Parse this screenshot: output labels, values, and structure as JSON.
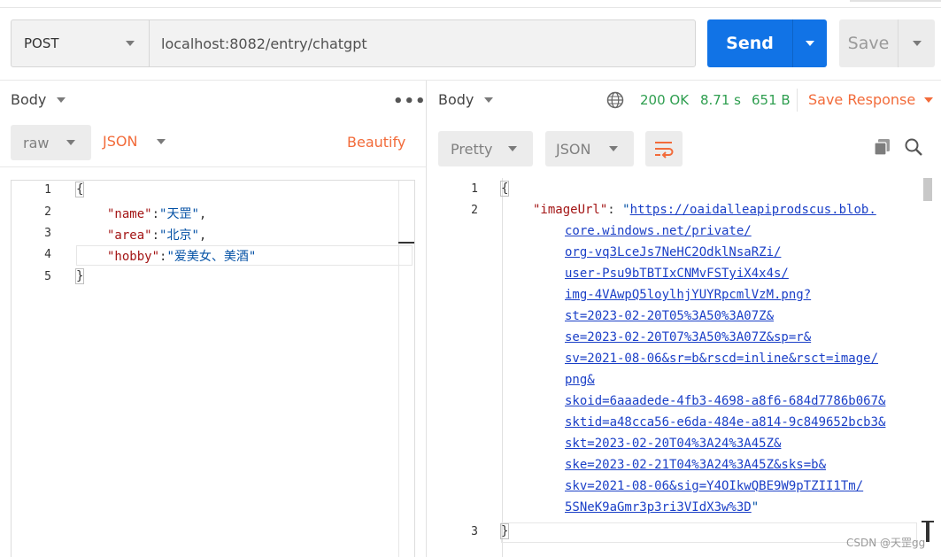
{
  "request": {
    "method": "POST",
    "url": "localhost:8082/entry/chatgpt",
    "send_label": "Send",
    "save_label": "Save"
  },
  "request_body": {
    "tab_label": "Body",
    "more_label": "•••",
    "mode": "raw",
    "format": "JSON",
    "beautify_label": "Beautify",
    "line_numbers": [
      "1",
      "2",
      "3",
      "4",
      "5"
    ],
    "lines": [
      {
        "open": "{"
      },
      {
        "key": "\"name\"",
        "colon": ":",
        "value": "\"天罡\"",
        "comma": ","
      },
      {
        "key": "\"area\"",
        "colon": ":",
        "value": "\"北京\"",
        "comma": ","
      },
      {
        "key": "\"hobby\"",
        "colon": ":",
        "value": "\"爱美女、美酒\"",
        "comma": ""
      },
      {
        "close": "}"
      }
    ]
  },
  "response": {
    "tab_label": "Body",
    "status": "200 OK",
    "time": "8.71 s",
    "size": "651 B",
    "save_response_label": "Save Response",
    "view_mode": "Pretty",
    "format": "JSON",
    "line_numbers": [
      "1",
      "2",
      "3"
    ],
    "open_brace": "{",
    "close_brace": "}",
    "key": "\"imageUrl\"",
    "colon": ":",
    "quote_open": "\"",
    "quote_close": "\"",
    "url_lines": [
      "https://oaidalleapiprodscus.blob.",
      "core.windows.net/private/",
      "org-vq3LceJs7NeHC2OdklNsaRZi/",
      "user-Psu9bTBTIxCNMvFSTyiX4x4s/",
      "img-4VAwpQ5loylhjYUYRpcmlVzM.png?",
      "st=2023-02-20T05%3A50%3A07Z&",
      "se=2023-02-20T07%3A50%3A07Z&sp=r&",
      "sv=2021-08-06&sr=b&rscd=inline&rsct=image/",
      "png&",
      "skoid=6aaadede-4fb3-4698-a8f6-684d7786b067&",
      "sktid=a48cca56-e6da-484e-a814-9c849652bcb3&",
      "skt=2023-02-20T04%3A24%3A45Z&",
      "ske=2023-02-21T04%3A24%3A45Z&sks=b&",
      "skv=2021-08-06&sig=Y4OIkwQBE9W9pTZII1Tm/",
      "5SNeK9aGmr3p3ri3VIdX3w%3D"
    ]
  },
  "watermark": "CSDN @天罡gg",
  "colors": {
    "send": "#1173e6",
    "accent_orange": "#f26b3a",
    "status_green": "#2e9e4f",
    "json_key": "#a31515",
    "json_string": "#0451a5",
    "link": "#1a3fc7"
  },
  "icons": [
    "chevron-down-icon",
    "more-dots-icon",
    "globe-icon",
    "wrap-lines-icon",
    "copy-icon",
    "search-icon"
  ]
}
